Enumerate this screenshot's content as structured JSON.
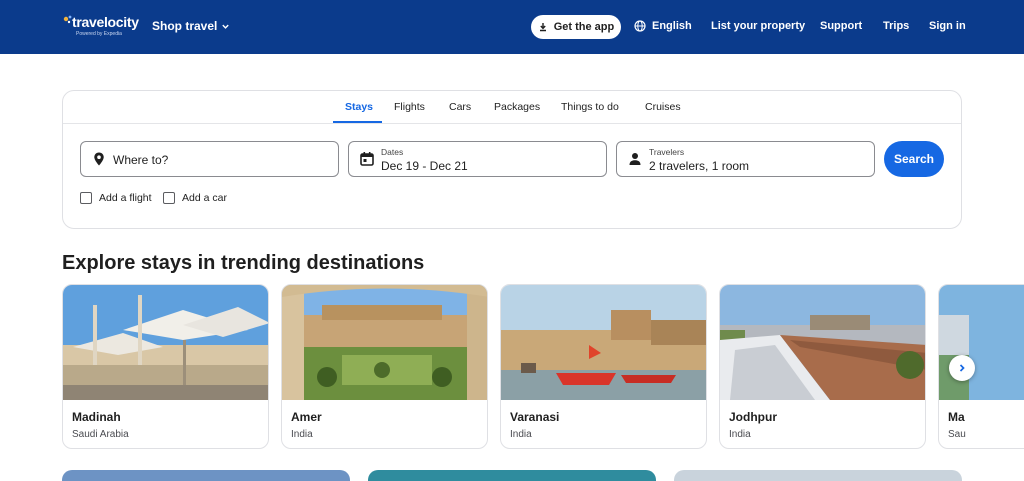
{
  "header": {
    "logo_text": "travelocity",
    "logo_sub": "Powered by Expedia",
    "shop_travel": "Shop travel",
    "get_app": "Get the app",
    "language": "English",
    "list_property": "List your property",
    "support": "Support",
    "trips": "Trips",
    "sign_in": "Sign in",
    "brand_color": "#0b3b8c"
  },
  "search": {
    "tabs": [
      {
        "label": "Stays",
        "active": true
      },
      {
        "label": "Flights"
      },
      {
        "label": "Cars"
      },
      {
        "label": "Packages"
      },
      {
        "label": "Things to do"
      },
      {
        "label": "Cruises"
      }
    ],
    "destination_placeholder": "Where to?",
    "dates_label": "Dates",
    "dates_value": "Dec 19 - Dec 21",
    "travelers_label": "Travelers",
    "travelers_value": "2 travelers, 1 room",
    "search_button": "Search",
    "add_flight": "Add a flight",
    "add_car": "Add a car",
    "accent_color": "#1668e3"
  },
  "trending": {
    "title": "Explore stays in trending destinations",
    "destinations": [
      {
        "name": "Madinah",
        "country": "Saudi Arabia"
      },
      {
        "name": "Amer",
        "country": "India"
      },
      {
        "name": "Varanasi",
        "country": "India"
      },
      {
        "name": "Jodhpur",
        "country": "India"
      },
      {
        "name": "Ma",
        "country": "Sau"
      }
    ]
  },
  "icons": {
    "shop_travel": "chevron-down-icon",
    "get_app": "download-icon",
    "language": "globe-icon",
    "destination": "location-pin-icon",
    "dates": "calendar-icon",
    "travelers": "person-icon",
    "carousel_next": "chevron-right-icon"
  }
}
